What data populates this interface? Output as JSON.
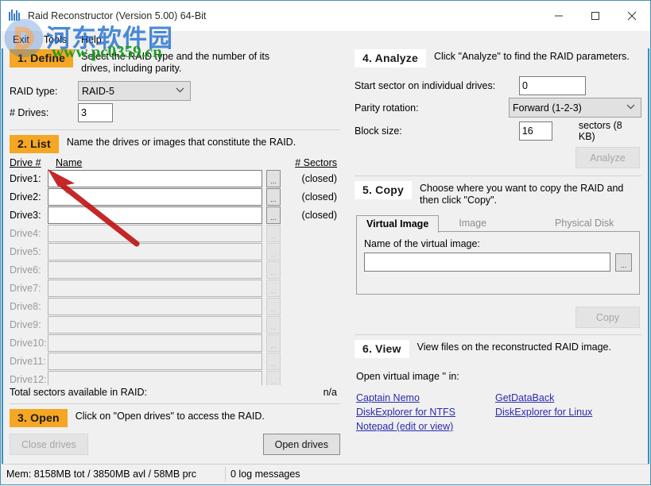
{
  "window": {
    "title": "Raid Reconstructor (Version 5.00) 64-Bit",
    "minimize": "minimize-icon",
    "maximize": "maximize-icon",
    "close": "close-icon"
  },
  "menu": {
    "items": [
      "Exit",
      "Tools",
      "Help"
    ]
  },
  "define": {
    "step": "1. Define",
    "desc": "Select the RAID type and the number of its drives, including parity.",
    "raid_type_label": "RAID type:",
    "raid_type_value": "RAID-5",
    "raid_type_options": [
      "RAID-5"
    ],
    "drives_label": "# Drives:",
    "drives_value": "3"
  },
  "list": {
    "step": "2. List",
    "desc": "Name the drives or images that constitute the RAID.",
    "col_drive": "Drive #",
    "col_name": "Name",
    "col_sectors": "# Sectors",
    "browse_label": "...",
    "rows": [
      {
        "label": "Drive1:",
        "value": "",
        "sectors": "(closed)",
        "enabled": true
      },
      {
        "label": "Drive2:",
        "value": "",
        "sectors": "(closed)",
        "enabled": true
      },
      {
        "label": "Drive3:",
        "value": "",
        "sectors": "(closed)",
        "enabled": true
      },
      {
        "label": "Drive4:",
        "value": "",
        "sectors": "",
        "enabled": false
      },
      {
        "label": "Drive5:",
        "value": "",
        "sectors": "",
        "enabled": false
      },
      {
        "label": "Drive6:",
        "value": "",
        "sectors": "",
        "enabled": false
      },
      {
        "label": "Drive7:",
        "value": "",
        "sectors": "",
        "enabled": false
      },
      {
        "label": "Drive8:",
        "value": "",
        "sectors": "",
        "enabled": false
      },
      {
        "label": "Drive9:",
        "value": "",
        "sectors": "",
        "enabled": false
      },
      {
        "label": "Drive10:",
        "value": "",
        "sectors": "",
        "enabled": false
      },
      {
        "label": "Drive11:",
        "value": "",
        "sectors": "",
        "enabled": false
      },
      {
        "label": "Drive12:",
        "value": "",
        "sectors": "",
        "enabled": false
      }
    ],
    "total_label": "Total sectors available in RAID:",
    "total_value": "n/a"
  },
  "open": {
    "step": "3. Open",
    "desc": "Click on \"Open drives\" to access the RAID.",
    "close_drives": "Close drives",
    "open_drives": "Open drives"
  },
  "analyze": {
    "step": "4. Analyze",
    "desc": "Click \"Analyze\" to find the RAID parameters.",
    "start_sector_label": "Start sector on individual drives:",
    "start_sector_value": "0",
    "parity_label": "Parity rotation:",
    "parity_value": "Forward (1-2-3)",
    "parity_options": [
      "Forward (1-2-3)"
    ],
    "block_size_label": "Block size:",
    "block_size_value": "16",
    "block_size_units": "sectors (8 KB)",
    "analyze_button": "Analyze"
  },
  "copy": {
    "step": "5. Copy",
    "desc": "Choose where you want to copy the RAID and then click \"Copy\".",
    "tabs": [
      "Virtual Image",
      "Image",
      "Physical Disk"
    ],
    "active_tab": "Virtual Image",
    "virtual_name_label": "Name of the virtual image:",
    "virtual_name_value": "",
    "browse_label": "...",
    "copy_button": "Copy"
  },
  "view": {
    "step": "6. View",
    "desc": "View files on the reconstructed RAID image.",
    "open_in_label": "Open virtual image '' in:",
    "links_left": [
      "Captain Nemo",
      "DiskExplorer for NTFS",
      "Notepad (edit or view)"
    ],
    "links_right": [
      "GetDataBack",
      "DiskExplorer for Linux"
    ]
  },
  "statusbar": {
    "memory": "Mem: 8158MB tot / 3850MB avl / 58MB prc",
    "log": "0 log messages"
  },
  "watermark": {
    "site_cn": "河东软件园",
    "site_url": "www.pc0359.cn"
  },
  "colors": {
    "step_accent": "#f5a623",
    "window_border": "#4a90b8",
    "link": "#2a2ab0",
    "arrow": "#c01818",
    "watermark_blue": "#1f6fd0",
    "watermark_green": "#1a9a1a"
  }
}
